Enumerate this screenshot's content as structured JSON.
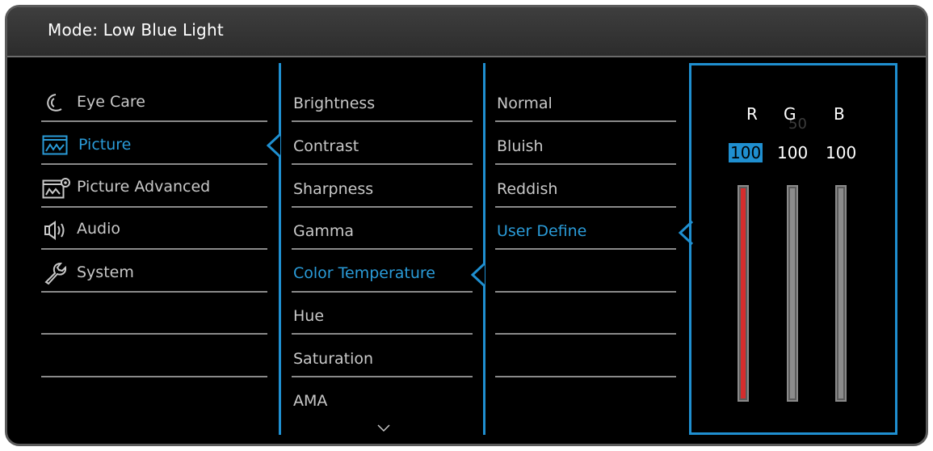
{
  "header": {
    "title": "Mode: Low Blue Light"
  },
  "main_menu": {
    "items": [
      {
        "label": "Eye Care",
        "icon": "eye-care-icon",
        "active": false
      },
      {
        "label": "Picture",
        "icon": "picture-icon",
        "active": true
      },
      {
        "label": "Picture Advanced",
        "icon": "picture-advanced-icon",
        "active": false
      },
      {
        "label": "Audio",
        "icon": "audio-icon",
        "active": false
      },
      {
        "label": "System",
        "icon": "system-icon",
        "active": false
      }
    ]
  },
  "picture_menu": {
    "items": [
      {
        "label": "Brightness",
        "active": false
      },
      {
        "label": "Contrast",
        "active": false
      },
      {
        "label": "Sharpness",
        "active": false
      },
      {
        "label": "Gamma",
        "active": false
      },
      {
        "label": "Color Temperature",
        "active": true
      },
      {
        "label": "Hue",
        "active": false
      },
      {
        "label": "Saturation",
        "active": false
      },
      {
        "label": "AMA",
        "active": false
      }
    ]
  },
  "color_temp_menu": {
    "items": [
      {
        "label": "Normal",
        "active": false
      },
      {
        "label": "Bluish",
        "active": false
      },
      {
        "label": "Reddish",
        "active": false
      },
      {
        "label": "User Define",
        "active": true
      }
    ]
  },
  "user_define": {
    "ghost_value": "50",
    "channels": [
      {
        "label": "R",
        "value": "100",
        "level": 1.0,
        "color": "#d42d2d",
        "selected": true
      },
      {
        "label": "G",
        "value": "100",
        "level": 1.0,
        "color": "#8c8c8c",
        "selected": false
      },
      {
        "label": "B",
        "value": "100",
        "level": 1.0,
        "color": "#8c8c8c",
        "selected": false
      }
    ]
  },
  "colors": {
    "accent": "#1f8fd0",
    "text": "#c8c8c8",
    "background": "#000000"
  }
}
